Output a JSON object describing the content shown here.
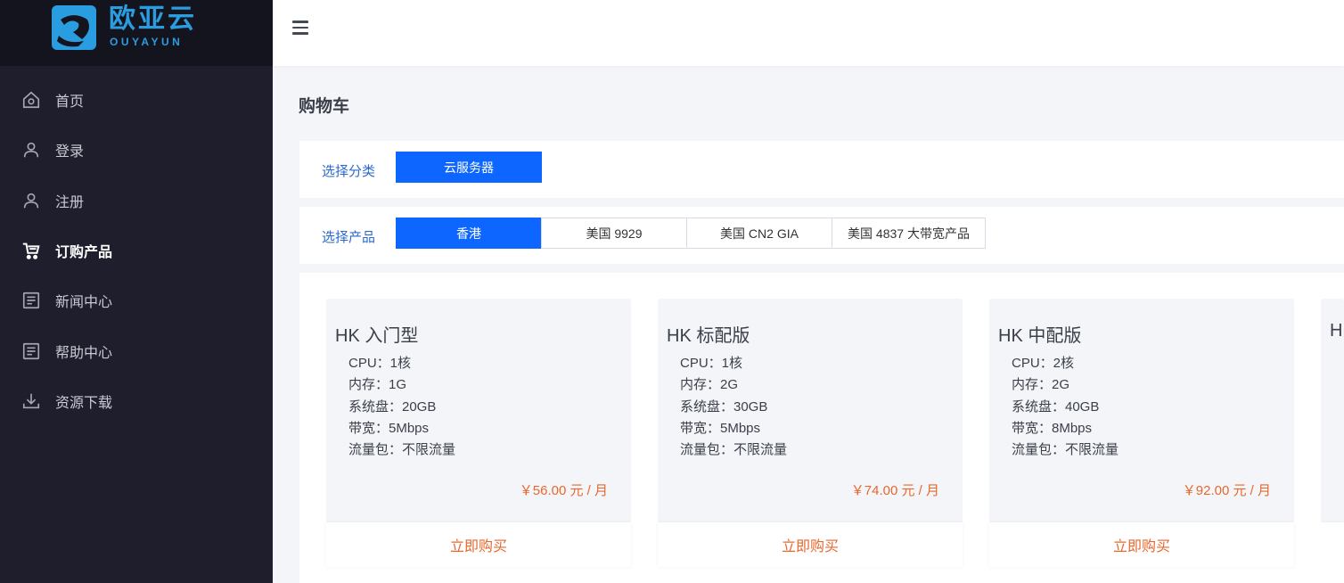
{
  "brand": {
    "name": "欧亚云",
    "subtitle": "OUYAYUN",
    "color": "#2a9de0"
  },
  "sidebar": {
    "items": [
      {
        "label": "首页",
        "icon": "home-icon",
        "active": false
      },
      {
        "label": "登录",
        "icon": "user-icon",
        "active": false
      },
      {
        "label": "注册",
        "icon": "user-icon",
        "active": false
      },
      {
        "label": "订购产品",
        "icon": "cart-icon",
        "active": true
      },
      {
        "label": "新闻中心",
        "icon": "document-icon",
        "active": false
      },
      {
        "label": "帮助中心",
        "icon": "document-icon",
        "active": false
      },
      {
        "label": "资源下载",
        "icon": "download-icon",
        "active": false
      }
    ]
  },
  "header": {
    "menu_icon": "hamburger-menu-icon"
  },
  "page": {
    "title": "购物车"
  },
  "category": {
    "label": "选择分类",
    "options": [
      {
        "label": "云服务器",
        "selected": true
      }
    ]
  },
  "product": {
    "label": "选择产品",
    "options": [
      {
        "label": "香港",
        "selected": true
      },
      {
        "label": "美国 9929",
        "selected": false
      },
      {
        "label": "美国 CN2 GIA",
        "selected": false
      },
      {
        "label": "美国 4837 大带宽产品",
        "selected": false
      }
    ]
  },
  "cards": [
    {
      "title": "HK 入门型",
      "specs": [
        "CPU：1核",
        "内存：1G",
        "系统盘：20GB",
        "带宽：5Mbps",
        "流量包：不限流量"
      ],
      "price": "￥56.00 元 / 月",
      "buy_label": "立即购买"
    },
    {
      "title": "HK 标配版",
      "specs": [
        "CPU：1核",
        "内存：2G",
        "系统盘：30GB",
        "带宽：5Mbps",
        "流量包：不限流量"
      ],
      "price": "￥74.00 元 / 月",
      "buy_label": "立即购买"
    },
    {
      "title": "HK 中配版",
      "specs": [
        "CPU：2核",
        "内存：2G",
        "系统盘：40GB",
        "带宽：8Mbps",
        "流量包：不限流量"
      ],
      "price": "￥92.00 元 / 月",
      "buy_label": "立即购买"
    },
    {
      "title": "H",
      "specs": [],
      "price": "",
      "buy_label": ""
    }
  ],
  "colors": {
    "accent": "#0d66ff",
    "price": "#e8672d",
    "sidebar_bg": "#1e1e2d"
  }
}
